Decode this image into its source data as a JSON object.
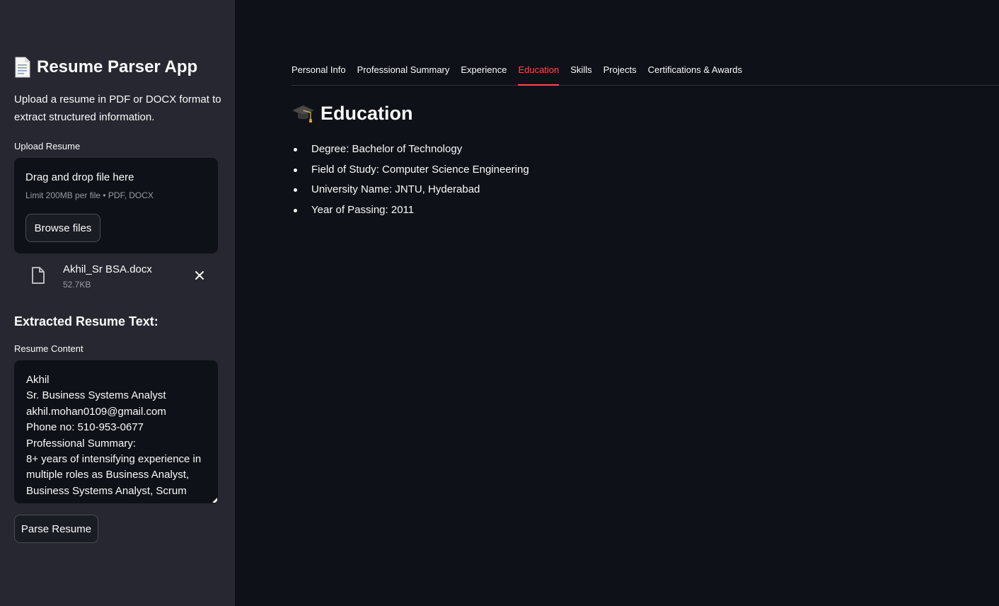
{
  "sidebar": {
    "app_title": "Resume Parser App",
    "app_icon": "page-document-icon",
    "description": "Upload a resume in PDF or DOCX format to extract structured information.",
    "upload_label": "Upload Resume",
    "dropzone": {
      "title": "Drag and drop file here",
      "limit": "Limit 200MB per file • PDF, DOCX",
      "browse_label": "Browse files"
    },
    "uploaded_file": {
      "name": "Akhil_Sr BSA.docx",
      "size": "52.7KB"
    },
    "extracted_title": "Extracted Resume Text:",
    "content_label": "Resume Content",
    "content_lines": [
      "Akhil",
      "Sr. Business Systems Analyst",
      "akhil.mohan0109@gmail.com",
      "Phone no: 510-953-0677",
      "Professional Summary:",
      "8+ years of intensifying experience in",
      "multiple roles as Business Analyst,",
      "Business Systems Analyst, Scrum"
    ],
    "parse_label": "Parse Resume"
  },
  "tabs": [
    {
      "label": "Personal Info",
      "active": false
    },
    {
      "label": "Professional Summary",
      "active": false
    },
    {
      "label": "Experience",
      "active": false
    },
    {
      "label": "Education",
      "active": true
    },
    {
      "label": "Skills",
      "active": false
    },
    {
      "label": "Projects",
      "active": false
    },
    {
      "label": "Certifications & Awards",
      "active": false
    }
  ],
  "main": {
    "section_title": "Education",
    "section_icon": "graduation-cap-icon",
    "items": [
      "Degree: Bachelor of Technology",
      "Field of Study: Computer Science Engineering",
      "University Name: JNTU, Hyderabad",
      "Year of Passing: 2011"
    ]
  },
  "colors": {
    "accent": "#ff4b4b",
    "background": "#0e1117",
    "sidebar": "#262730"
  }
}
